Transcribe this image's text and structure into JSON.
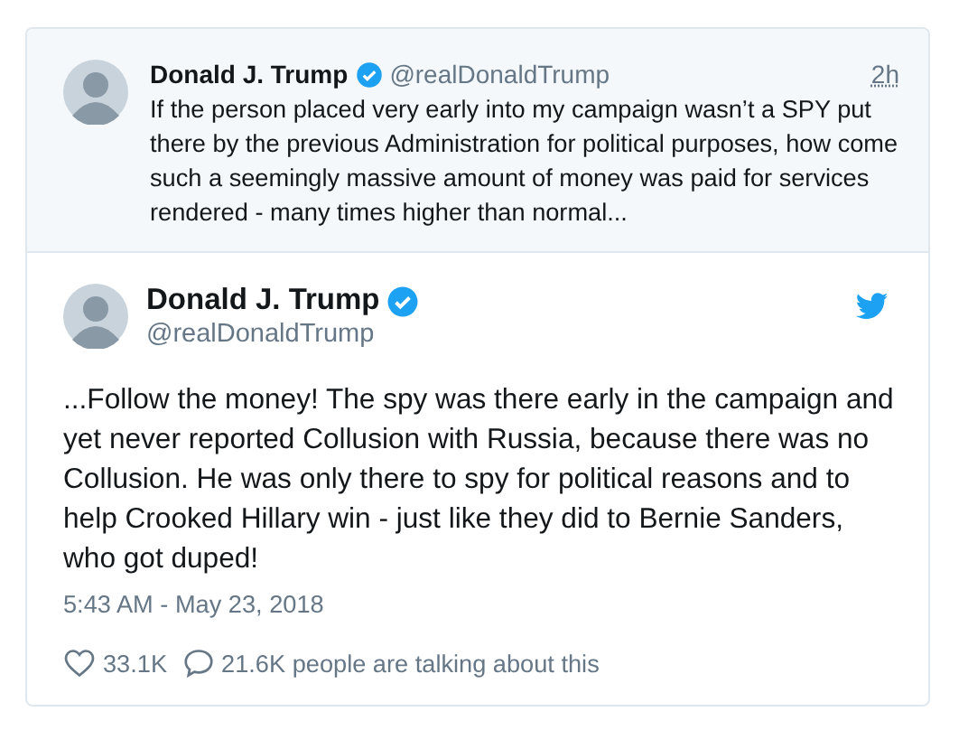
{
  "quoted_tweet": {
    "name": "Donald J. Trump",
    "verified": true,
    "handle": "@realDonaldTrump",
    "time": "2h",
    "text": "If the person placed very early into my campaign wasn’t a SPY put there by the previous Administration for political purposes, how come such a seemingly massive amount of money was paid for services rendered - many times higher than normal..."
  },
  "tweet": {
    "name": "Donald J. Trump",
    "verified": true,
    "handle": "@realDonaldTrump",
    "text": "...Follow the money! The spy was there early in the campaign and yet never reported Collusion with Russia, because there was no Collusion. He was only there to spy for political reasons and to help Crooked Hillary win - just like they did to Bernie Sanders, who got duped!",
    "timestamp": "5:43 AM - May 23, 2018",
    "likes": "33.1K",
    "talking": "21.6K people are talking about this"
  }
}
